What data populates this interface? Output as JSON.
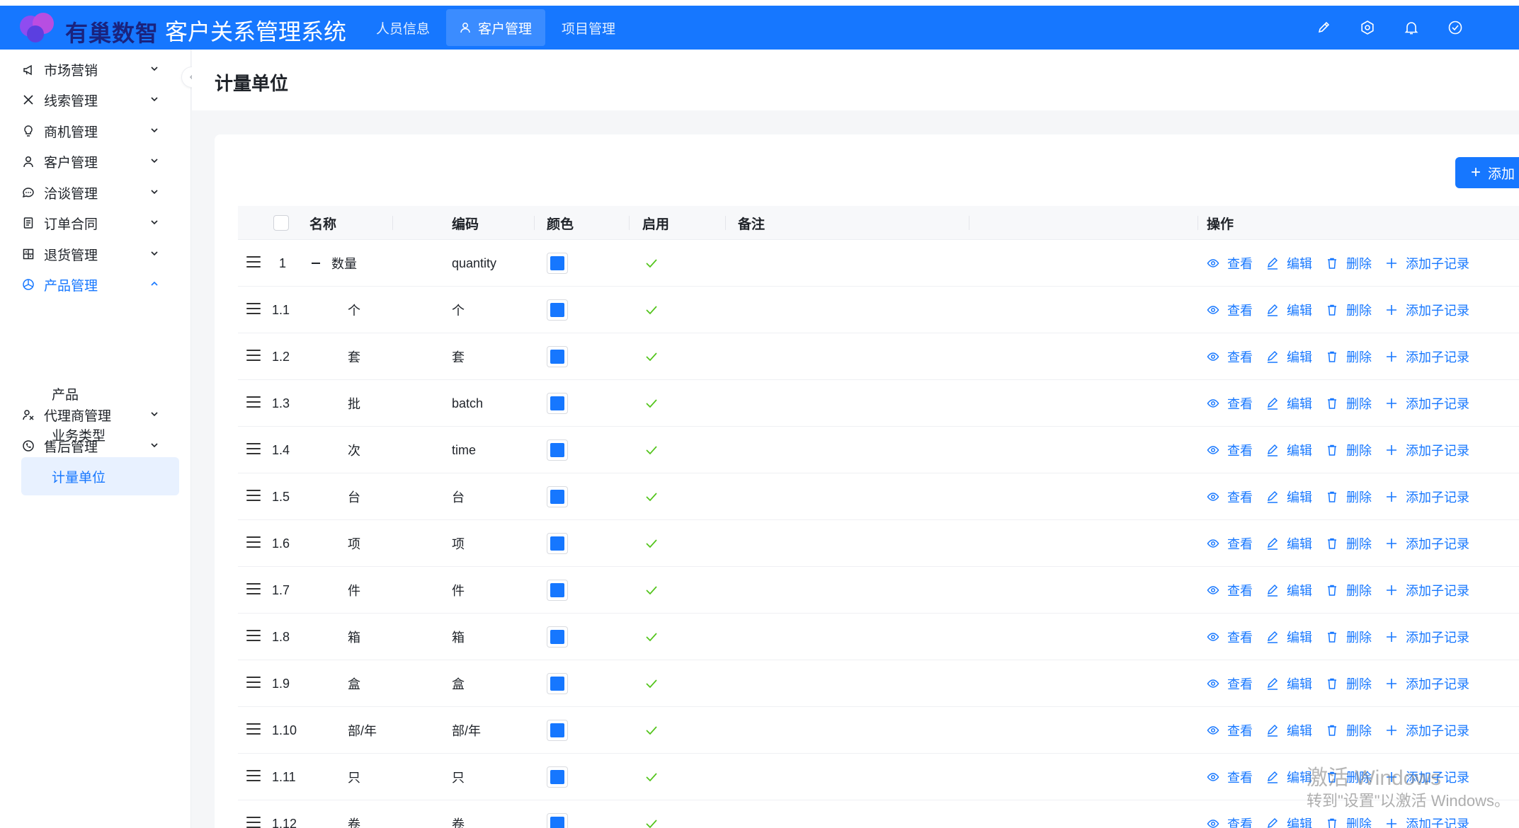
{
  "header": {
    "logo_text": "有巢数智",
    "system_title": "客户关系管理系统",
    "nav": [
      {
        "label": "人员信息",
        "active": false
      },
      {
        "label": "客户管理",
        "active": true
      },
      {
        "label": "项目管理",
        "active": false
      }
    ],
    "icons": [
      "brush-icon",
      "gear-icon",
      "bell-icon",
      "check-circle-icon"
    ],
    "accent": "#1677ff"
  },
  "sidebar": {
    "items": [
      {
        "label": "市场营销",
        "icon": "megaphone-icon"
      },
      {
        "label": "线索管理",
        "icon": "x-icon"
      },
      {
        "label": "商机管理",
        "icon": "bulb-icon"
      },
      {
        "label": "客户管理",
        "icon": "user-icon"
      },
      {
        "label": "洽谈管理",
        "icon": "chat-icon"
      },
      {
        "label": "订单合同",
        "icon": "document-icon"
      },
      {
        "label": "退货管理",
        "icon": "return-icon"
      },
      {
        "label": "产品管理",
        "icon": "product-icon",
        "open": true
      },
      {
        "label": "代理商管理",
        "icon": "agent-icon"
      },
      {
        "label": "售后管理",
        "icon": "whatsapp-icon"
      }
    ],
    "sub_items": [
      {
        "label": "产品"
      },
      {
        "label": "业务类型"
      },
      {
        "label": "计量单位",
        "active": true
      }
    ]
  },
  "page": {
    "title": "计量单位",
    "add_label": "添加"
  },
  "table": {
    "columns": [
      "名称",
      "编码",
      "颜色",
      "启用",
      "备注",
      "操作"
    ],
    "rows": [
      {
        "index": "1",
        "name": "数量",
        "code": "quantity",
        "color": "#1677ff",
        "enabled": true,
        "note": ""
      },
      {
        "index": "1.1",
        "name": "个",
        "code": "个",
        "color": "#1677ff",
        "enabled": true,
        "note": ""
      },
      {
        "index": "1.2",
        "name": "套",
        "code": "套",
        "color": "#1677ff",
        "enabled": true,
        "note": ""
      },
      {
        "index": "1.3",
        "name": "批",
        "code": "batch",
        "color": "#1677ff",
        "enabled": true,
        "note": ""
      },
      {
        "index": "1.4",
        "name": "次",
        "code": "time",
        "color": "#1677ff",
        "enabled": true,
        "note": ""
      },
      {
        "index": "1.5",
        "name": "台",
        "code": "台",
        "color": "#1677ff",
        "enabled": true,
        "note": ""
      },
      {
        "index": "1.6",
        "name": "项",
        "code": "项",
        "color": "#1677ff",
        "enabled": true,
        "note": ""
      },
      {
        "index": "1.7",
        "name": "件",
        "code": "件",
        "color": "#1677ff",
        "enabled": true,
        "note": ""
      },
      {
        "index": "1.8",
        "name": "箱",
        "code": "箱",
        "color": "#1677ff",
        "enabled": true,
        "note": ""
      },
      {
        "index": "1.9",
        "name": "盒",
        "code": "盒",
        "color": "#1677ff",
        "enabled": true,
        "note": ""
      },
      {
        "index": "1.10",
        "name": "部/年",
        "code": "部/年",
        "color": "#1677ff",
        "enabled": true,
        "note": ""
      },
      {
        "index": "1.11",
        "name": "只",
        "code": "只",
        "color": "#1677ff",
        "enabled": true,
        "note": ""
      },
      {
        "index": "1.12",
        "name": "卷",
        "code": "卷",
        "color": "#1677ff",
        "enabled": true,
        "note": ""
      }
    ],
    "actions": {
      "view": "查看",
      "edit": "编辑",
      "delete": "删除",
      "add_child": "添加子记录"
    }
  },
  "watermark": {
    "line1": "激活 Windows",
    "line2": "转到\"设置\"以激活 Windows。"
  }
}
